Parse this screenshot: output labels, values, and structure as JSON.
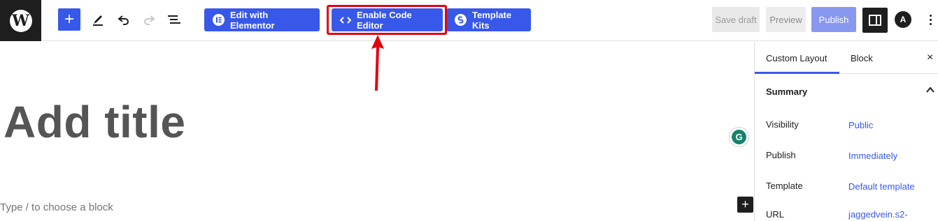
{
  "toolbar": {
    "logo_glyph": "W",
    "add_block": "+",
    "edit_elementor": "Edit with Elementor",
    "enable_code_editor": "Enable Code Editor",
    "template_kits": "Template Kits",
    "save_draft": "Save draft",
    "preview": "Preview",
    "publish": "Publish",
    "astra_glyph": "A",
    "colors": {
      "accent": "#3858e9",
      "highlight": "#e3000f"
    },
    "icons": [
      "wordpress-icon",
      "plus-icon",
      "pen-icon",
      "undo-icon",
      "redo-icon",
      "list-view-icon",
      "elementor-icon",
      "code-icon",
      "template-kits-icon",
      "sidebar-toggle-icon",
      "astra-icon",
      "more-options-icon"
    ]
  },
  "editor": {
    "title_placeholder": "Add title",
    "block_placeholder": "Type / to choose a block",
    "grammarly_glyph": "G",
    "inline_add": "+"
  },
  "sidebar": {
    "tabs": [
      "Custom Layout",
      "Block"
    ],
    "close": "×",
    "summary": "Summary",
    "rows": [
      {
        "label": "Visibility",
        "value": "Public"
      },
      {
        "label": "Publish",
        "value": "Immediately"
      },
      {
        "label": "Template",
        "value": "Default template"
      },
      {
        "label": "URL",
        "value": "jaggedvein.s2-"
      }
    ]
  }
}
